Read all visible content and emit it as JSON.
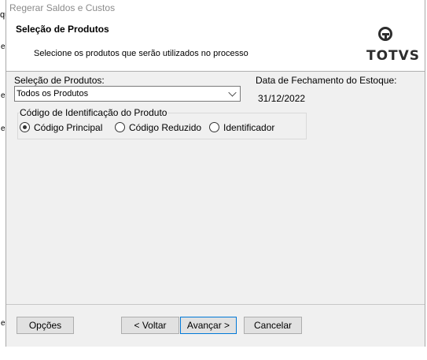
{
  "background": {
    "title_fragment": "qu",
    "marks": [
      "e",
      "e",
      "e",
      "e"
    ]
  },
  "window": {
    "title": "Regerar Saldos e Custos"
  },
  "header": {
    "title": "Seleção de Produtos",
    "subtitle": "Selecione os produtos que serão utilizados no processo",
    "logo_text": "TOTVS"
  },
  "form": {
    "selection_label": "Seleção de Produtos:",
    "selection_value": "Todos os Produtos",
    "closing_date_label": "Data de Fechamento do Estoque:",
    "closing_date_value": "31/12/2022",
    "id_group_label": "Código de Identificação do Produto",
    "options": [
      {
        "label": "Código Principal",
        "checked": true
      },
      {
        "label": "Código Reduzido",
        "checked": false
      },
      {
        "label": "Identificador",
        "checked": false
      }
    ]
  },
  "buttons": {
    "options": "Opções",
    "back": "< Voltar",
    "next": "Avançar >",
    "cancel": "Cancelar"
  }
}
